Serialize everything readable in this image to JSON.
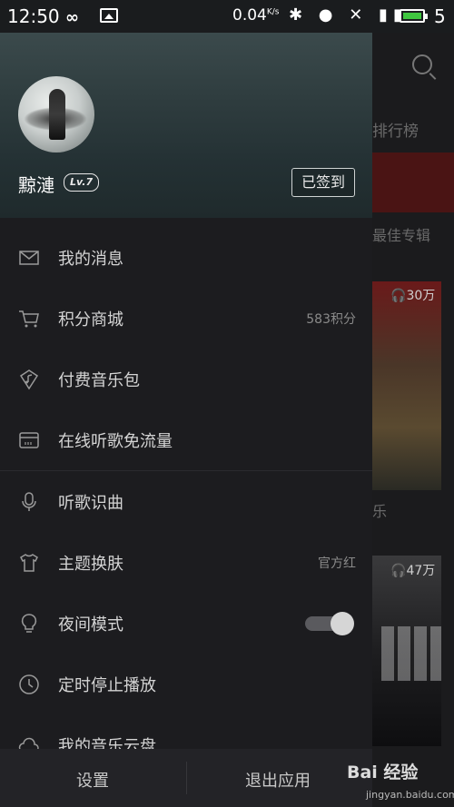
{
  "status_bar": {
    "time": "12:50",
    "speed": "0.04",
    "speed_unit": "K/s",
    "battery_num": "5"
  },
  "background": {
    "tab_label": "排行榜",
    "section_label": "最佳专辑",
    "album1_count": "30万",
    "album_caption": "乐",
    "album2_count": "47万"
  },
  "profile": {
    "username": "黥漣",
    "level": "Lv.7",
    "signin_label": "已签到"
  },
  "menu": [
    {
      "label": "我的消息"
    },
    {
      "label": "积分商城",
      "value": "583积分"
    },
    {
      "label": "付费音乐包"
    },
    {
      "label": "在线听歌免流量"
    },
    {
      "label": "听歌识曲"
    },
    {
      "label": "主题换肤",
      "value": "官方红"
    },
    {
      "label": "夜间模式"
    },
    {
      "label": "定时停止播放"
    },
    {
      "label": "我的音乐云盘"
    }
  ],
  "bottom": {
    "settings_label": "设置",
    "exit_label": "退出应用"
  },
  "watermark": {
    "brand": "Bai 经验",
    "url": "jingyan.baidu.com"
  }
}
